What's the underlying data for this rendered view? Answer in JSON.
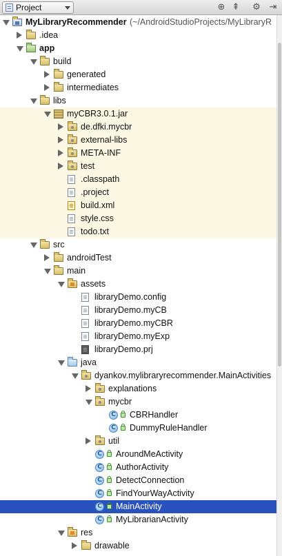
{
  "toolbar": {
    "view_label": "Project",
    "icons": [
      "target-icon",
      "collapse-all-icon",
      "gear-icon",
      "hide-panel-icon"
    ]
  },
  "colors": {
    "selection": "#2a52be",
    "library_band": "#fcf8e3"
  },
  "tree": [
    {
      "label": "MyLibraryRecommender",
      "note": "(~/AndroidStudioProjects/MyLibraryR",
      "icon": "project-folder-icon",
      "depth": 0,
      "state": "expanded",
      "bold": true
    },
    {
      "label": ".idea",
      "icon": "folder-icon",
      "depth": 1,
      "state": "collapsed"
    },
    {
      "label": "app",
      "icon": "module-folder-icon",
      "depth": 1,
      "state": "expanded",
      "bold": true
    },
    {
      "label": "build",
      "icon": "folder-icon",
      "depth": 2,
      "state": "expanded"
    },
    {
      "label": "generated",
      "icon": "folder-icon",
      "depth": 3,
      "state": "collapsed"
    },
    {
      "label": "intermediates",
      "icon": "folder-icon",
      "depth": 3,
      "state": "collapsed"
    },
    {
      "label": "libs",
      "icon": "folder-icon",
      "depth": 2,
      "state": "expanded"
    },
    {
      "label": "myCBR3.0.1.jar",
      "icon": "jar-icon",
      "depth": 3,
      "state": "expanded",
      "band": true
    },
    {
      "label": "de.dfki.mycbr",
      "icon": "package-folder-icon",
      "depth": 4,
      "state": "collapsed",
      "band": true
    },
    {
      "label": "external-libs",
      "icon": "package-folder-icon",
      "depth": 4,
      "state": "collapsed",
      "band": true
    },
    {
      "label": "META-INF",
      "icon": "package-folder-icon",
      "depth": 4,
      "state": "collapsed",
      "band": true
    },
    {
      "label": "test",
      "icon": "package-folder-icon",
      "depth": 4,
      "state": "collapsed",
      "band": true
    },
    {
      "label": ".classpath",
      "icon": "file-icon",
      "depth": 4,
      "state": "leaf",
      "band": true
    },
    {
      "label": ".project",
      "icon": "file-icon",
      "depth": 4,
      "state": "leaf",
      "band": true
    },
    {
      "label": "build.xml",
      "icon": "xml-file-icon",
      "depth": 4,
      "state": "leaf",
      "band": true
    },
    {
      "label": "style.css",
      "icon": "file-icon",
      "depth": 4,
      "state": "leaf",
      "band": true
    },
    {
      "label": "todo.txt",
      "icon": "file-icon",
      "depth": 4,
      "state": "leaf",
      "band": true
    },
    {
      "label": "src",
      "icon": "folder-icon",
      "depth": 2,
      "state": "expanded"
    },
    {
      "label": "androidTest",
      "icon": "folder-icon",
      "depth": 3,
      "state": "collapsed"
    },
    {
      "label": "main",
      "icon": "folder-icon",
      "depth": 3,
      "state": "expanded"
    },
    {
      "label": "assets",
      "icon": "resource-folder-icon",
      "depth": 4,
      "state": "expanded"
    },
    {
      "label": "libraryDemo.config",
      "icon": "file-icon",
      "depth": 5,
      "state": "leaf"
    },
    {
      "label": "libraryDemo.myCB",
      "icon": "file-icon",
      "depth": 5,
      "state": "leaf"
    },
    {
      "label": "libraryDemo.myCBR",
      "icon": "file-icon",
      "depth": 5,
      "state": "leaf"
    },
    {
      "label": "libraryDemo.myExp",
      "icon": "file-icon",
      "depth": 5,
      "state": "leaf"
    },
    {
      "label": "libraryDemo.prj",
      "icon": "prj-file-icon",
      "depth": 5,
      "state": "leaf"
    },
    {
      "label": "java",
      "icon": "source-folder-icon",
      "depth": 4,
      "state": "expanded"
    },
    {
      "label": "dyankov.mylibraryrecommender.MainActivities",
      "icon": "package-folder-icon",
      "depth": 5,
      "state": "expanded"
    },
    {
      "label": "explanations",
      "icon": "package-folder-icon",
      "depth": 6,
      "state": "collapsed"
    },
    {
      "label": "mycbr",
      "icon": "package-folder-icon",
      "depth": 6,
      "state": "expanded"
    },
    {
      "label": "CBRHandler",
      "icon": "class-icon",
      "depth": 7,
      "state": "leaf",
      "lock": true
    },
    {
      "label": "DummyRuleHandler",
      "icon": "class-icon",
      "depth": 7,
      "state": "leaf",
      "lock": true
    },
    {
      "label": "util",
      "icon": "package-folder-icon",
      "depth": 6,
      "state": "collapsed"
    },
    {
      "label": "AroundMeActivity",
      "icon": "class-icon",
      "depth": 6,
      "state": "leaf",
      "lock": true
    },
    {
      "label": "AuthorActivity",
      "icon": "class-icon",
      "depth": 6,
      "state": "leaf",
      "lock": true
    },
    {
      "label": "DetectConnection",
      "icon": "class-icon",
      "depth": 6,
      "state": "leaf",
      "lock": true
    },
    {
      "label": "FindYourWayActivity",
      "icon": "class-icon",
      "depth": 6,
      "state": "leaf",
      "lock": true
    },
    {
      "label": "MainActivity",
      "icon": "class-icon",
      "depth": 6,
      "state": "leaf",
      "lock": true,
      "selected": true
    },
    {
      "label": "MyLibrarianActivity",
      "icon": "class-icon",
      "depth": 6,
      "state": "leaf",
      "lock": true
    },
    {
      "label": "res",
      "icon": "resource-folder-icon",
      "depth": 4,
      "state": "expanded"
    },
    {
      "label": "drawable",
      "icon": "folder-icon",
      "depth": 5,
      "state": "collapsed"
    }
  ]
}
